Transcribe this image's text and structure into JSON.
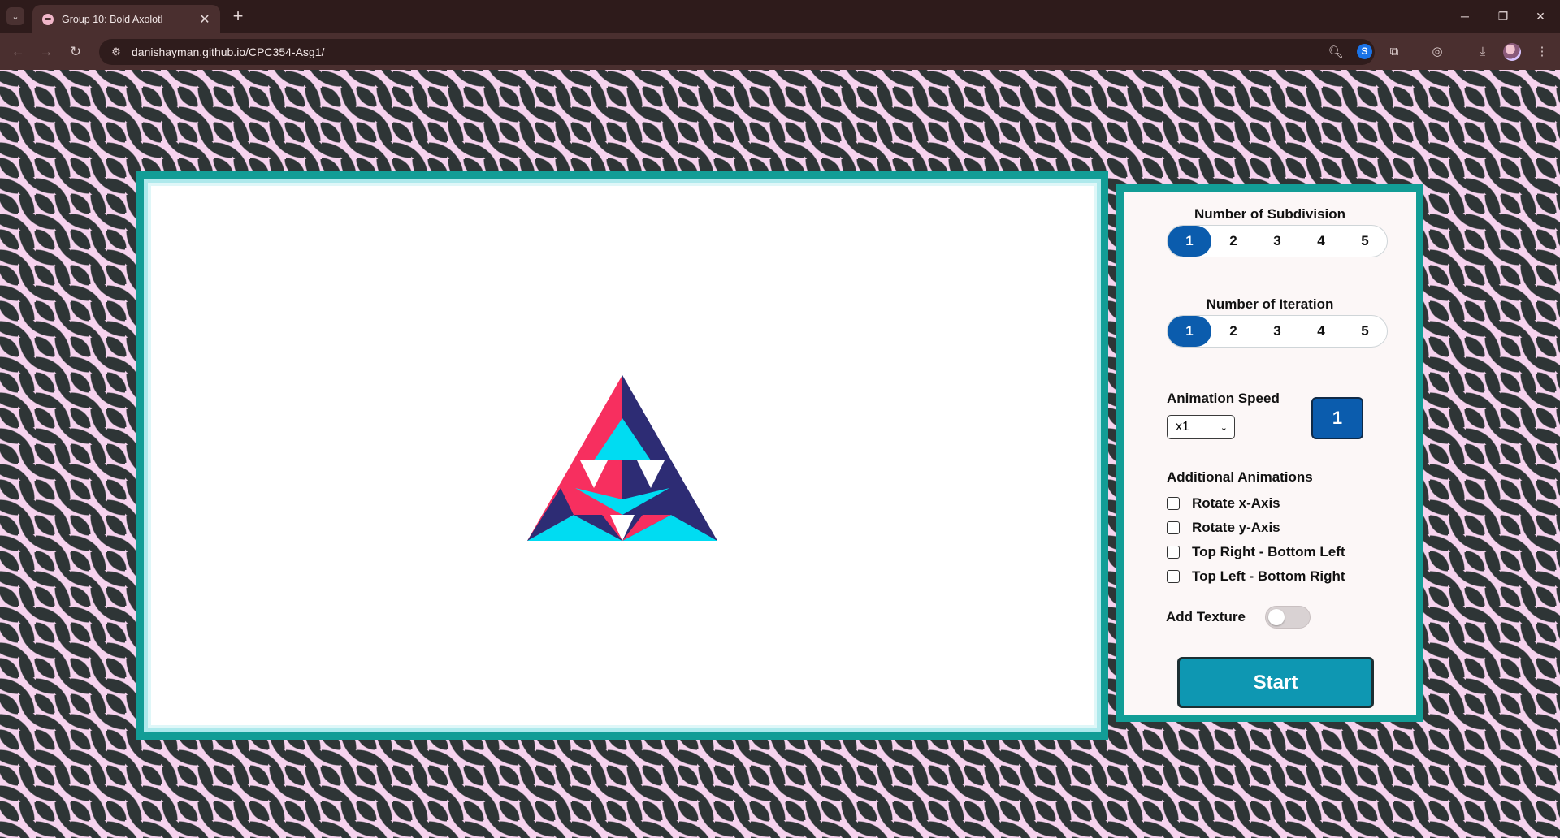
{
  "browser": {
    "tab_title": "Group 10: Bold Axolotl",
    "tab_close": "✕",
    "new_tab": "+",
    "url": "danishayman.github.io/CPC354-Asg1/"
  },
  "panel": {
    "subdivision": {
      "title": "Number of Subdivision",
      "options": [
        "1",
        "2",
        "3",
        "4",
        "5"
      ],
      "selected": "1"
    },
    "iteration": {
      "title": "Number of Iteration",
      "options": [
        "1",
        "2",
        "3",
        "4",
        "5"
      ],
      "selected": "1"
    },
    "speed": {
      "label": "Animation Speed",
      "selected_option": "x1",
      "value_badge": "1"
    },
    "additional": {
      "title": "Additional Animations",
      "items": [
        "Rotate x-Axis",
        "Rotate y-Axis",
        "Top Right - Bottom Left",
        "Top Left - Bottom Right"
      ],
      "checked": [
        false,
        false,
        false,
        false
      ]
    },
    "texture": {
      "label": "Add Texture",
      "enabled": false
    },
    "start_label": "Start"
  },
  "colors": {
    "accent_teal": "#129d96",
    "button_blue": "#0b5cad",
    "start_cyan": "#0e97b2",
    "tri_pink": "#f72f5f",
    "tri_navy": "#2d2c74",
    "tri_cyan": "#00dcf2",
    "pattern_dark": "#2e3536",
    "pattern_pink": "#f6d3ee"
  }
}
